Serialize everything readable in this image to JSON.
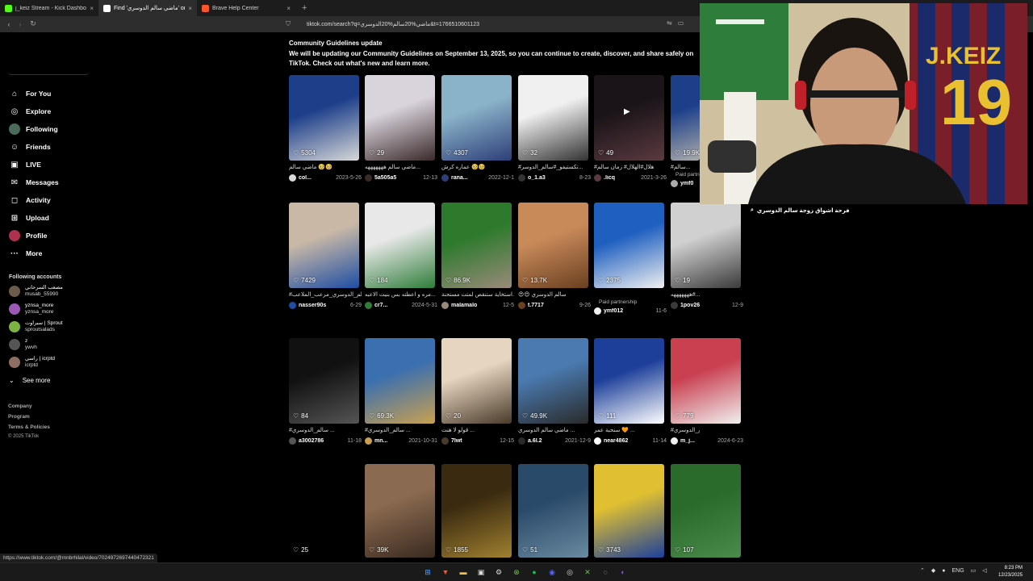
{
  "browser": {
    "tabs": [
      {
        "label": "j_keiz Stream - Kick Dashboard",
        "icon": "kick-icon",
        "color": "#53fc18",
        "active": false
      },
      {
        "label": "Find 'ماضي سالم الدوسري' on Tik",
        "icon": "tiktok-icon",
        "color": "#ffffff",
        "active": true
      },
      {
        "label": "Brave Help Center",
        "icon": "brave-icon",
        "color": "#fb542b",
        "active": false
      }
    ],
    "new_tab": "+",
    "url": "tiktok.com/search?q=ماضي%20سالم%20الدوسري&t=1766510601123"
  },
  "sidebar": {
    "nav": [
      {
        "label": "For You",
        "icon": "home-icon"
      },
      {
        "label": "Explore",
        "icon": "compass-icon"
      },
      {
        "label": "Following",
        "icon": "following-avatar-icon"
      },
      {
        "label": "Friends",
        "icon": "friends-icon"
      },
      {
        "label": "LIVE",
        "icon": "live-icon"
      },
      {
        "label": "Messages",
        "icon": "messages-icon"
      },
      {
        "label": "Activity",
        "icon": "activity-icon"
      },
      {
        "label": "Upload",
        "icon": "upload-icon"
      },
      {
        "label": "Profile",
        "icon": "profile-avatar-icon"
      },
      {
        "label": "More",
        "icon": "more-icon"
      }
    ],
    "following_title": "Following accounts",
    "accounts": [
      {
        "name": "مصعب السرحاني",
        "handle": "musab_55990",
        "color": "#6b5b4b"
      },
      {
        "name": "yznsa_more",
        "handle": "yznsa_more",
        "color": "#9b59b6"
      },
      {
        "name": "سبراوت | Sprout",
        "handle": "sproutsalads",
        "color": "#7cb342"
      },
      {
        "name": "z",
        "handle": "ywvh",
        "color": "#555555"
      },
      {
        "name": "راسي | icrptd",
        "handle": "icrptd",
        "color": "#8d6e63"
      }
    ],
    "see_more": "See more",
    "footer": [
      "Company",
      "Program",
      "Terms & Policies",
      "© 2025 TikTok"
    ]
  },
  "banner": {
    "title": "Community Guidelines update",
    "body": "We will be updating our Community Guidelines on September 13, 2025, so you can continue to create, discover, and share safely on TikTok. Check out what's new and learn more."
  },
  "videos": [
    {
      "likes": "5304",
      "caption": "ماضي سالم 🥹🥹",
      "user": "col...",
      "date": "2023-5-26",
      "c1": "#1d3f8a",
      "c2": "#d8d8d8"
    },
    {
      "likes": "29",
      "caption": "ماضي سالم هههههههه...",
      "user": "5a505a5",
      "date": "12-13",
      "c1": "#d9d3dc",
      "c2": "#3a2a2a"
    },
    {
      "likes": "4307",
      "caption": "عماره كرش 🥹🥹",
      "user": "rana...",
      "date": "2022-12-1",
      "c1": "#8ab3c9",
      "c2": "#2d3e78"
    },
    {
      "likes": "32",
      "caption": "#تكستيفو_#سالم_الدوسر...",
      "user": "o_1.a3",
      "date": "8-23",
      "c1": "#f0f0f0",
      "c2": "#333333"
    },
    {
      "likes": "49",
      "caption": "#هلال#الهلال# زمان سالم",
      "user": ".licq",
      "date": "2021-3-26",
      "c1": "#1a1418",
      "c2": "#5a3a40",
      "play": true
    },
    {
      "likes": "19.9K",
      "caption": "#سالم...",
      "user": "ymf0",
      "date": "",
      "partner": "Paid partnership",
      "c1": "#1d3f8a",
      "c2": "#aaaaaa"
    },
    {
      "likes": "7429",
      "caption": "#سالم_الدوسري_مرعب_الملاعب",
      "user": "nasser90s",
      "date": "6-29",
      "c1": "#c9b8a6",
      "c2": "#1e4ea3"
    },
    {
      "likes": "184",
      "caption": "مره و اعطته بس بنيت الاعبه...",
      "user": "cr7...",
      "date": "2024-5-31",
      "c1": "#e8e8e8",
      "c2": "#2f7d3a"
    },
    {
      "likes": "86.9K",
      "caption": "استخاية ستنقص لمتت مستحنة...",
      "user": "malamalo",
      "date": "12-5",
      "c1": "#2d7a2d",
      "c2": "#9a8a7a"
    },
    {
      "likes": "13.7K",
      "caption": "😍😍 سالم الدوسري",
      "user": "t.7717",
      "date": "9-26",
      "c1": "#c98a5a",
      "c2": "#6a4020"
    },
    {
      "likes": "2375",
      "caption": "",
      "user": "ymf012",
      "date": "11-6",
      "partner": "Paid partnership",
      "c1": "#1e5fc0",
      "c2": "#f0f0f0"
    },
    {
      "likes": "19",
      "caption": "سالم الدوسري ضمنن...#هههههههه",
      "user": "1pov26",
      "date": "12-9",
      "c1": "#d0d0d0",
      "c2": "#3a3a3a"
    },
    {
      "likes": "84",
      "caption": "#سالم_الدوسري ...",
      "user": "a3002786",
      "date": "11-18",
      "c1": "#111111",
      "c2": "#555555"
    },
    {
      "likes": "69.3K",
      "caption": "#سالم_الدوسري ...",
      "user": "mn...",
      "date": "2021-10-31",
      "c1": "#3a6fb0",
      "c2": "#c8a050"
    },
    {
      "likes": "20",
      "caption": "قولو لا هنت ...",
      "user": "7lwt",
      "date": "12-15",
      "c1": "#e6d6c0",
      "c2": "#4a3a2a"
    },
    {
      "likes": "49.9K",
      "caption": "ماضي سالم الدوسري ...",
      "user": "a.6l.2",
      "date": "2021-12-9",
      "c1": "#4a7ab0",
      "c2": "#2a2a2a"
    },
    {
      "likes": "111",
      "caption": "سنحبة عمر 🧡 ...",
      "user": "near4862",
      "date": "11-14",
      "c1": "#1d3f9a",
      "c2": "#ffffff"
    },
    {
      "likes": "779",
      "caption": "#قديم#سالم_الدوسري",
      "user": "m_j...",
      "date": "2024-6-23",
      "c1": "#c94050",
      "c2": "#f0f0f0"
    },
    {
      "likes": "25",
      "caption": "",
      "user": "",
      "date": "",
      "c1": "#000000",
      "c2": "#000000"
    },
    {
      "likes": "39K",
      "caption": "",
      "user": "",
      "date": "",
      "c1": "#8a6a50",
      "c2": "#3a2a20"
    },
    {
      "likes": "1855",
      "caption": "",
      "user": "",
      "date": "",
      "c1": "#3a2a10",
      "c2": "#a08030"
    },
    {
      "likes": "51",
      "caption": "",
      "user": "",
      "date": "",
      "c1": "#2a4a6a",
      "c2": "#6a8aa0"
    },
    {
      "likes": "3743",
      "caption": "",
      "user": "",
      "date": "",
      "c1": "#e0c030",
      "c2": "#1d3f9a"
    },
    {
      "likes": "107",
      "caption": "",
      "user": "",
      "date": "",
      "c1": "#2a6a2a",
      "c2": "#4a8a4a"
    }
  ],
  "search_suggestion": "فرحة اشواق زوجة سالم الدوسري",
  "status_url": "https://www.tiktok.com/@mnbrhilal/video/7024972697440472321",
  "taskbar": {
    "tray_lang": "ENG",
    "time": "8:23 PM",
    "date": "12/23/2025"
  },
  "webcam": {
    "jersey_text": "J.KEIZ",
    "jersey_number": "19"
  }
}
